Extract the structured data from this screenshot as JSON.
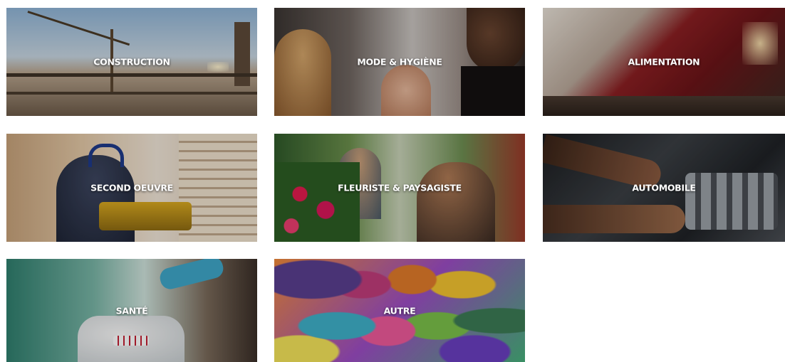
{
  "categories": [
    {
      "id": "construction",
      "label": "CONSTRUCTION"
    },
    {
      "id": "mode",
      "label": "MODE & HYGIÈNE"
    },
    {
      "id": "alimentation",
      "label": "ALIMENTATION"
    },
    {
      "id": "second",
      "label": "SECOND OEUVRE"
    },
    {
      "id": "fleuriste",
      "label": "FLEURISTE & PAYSAGISTE"
    },
    {
      "id": "automobile",
      "label": "AUTOMOBILE"
    },
    {
      "id": "sante",
      "label": "SANTÉ"
    },
    {
      "id": "autre",
      "label": "AUTRE"
    }
  ],
  "label_color": "#ffffff"
}
